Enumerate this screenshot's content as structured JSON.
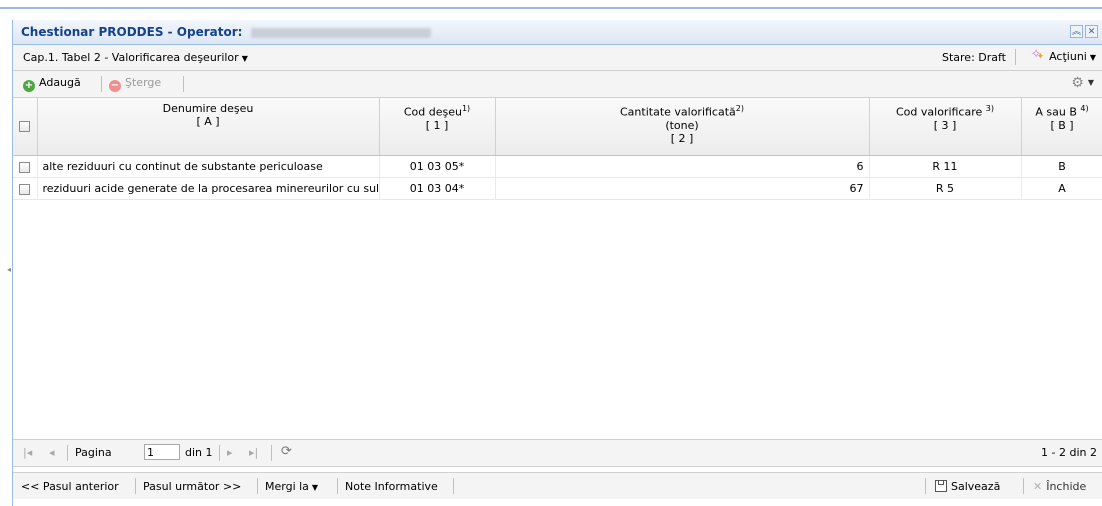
{
  "window": {
    "title": "Chestionar PRODDES - Operator:",
    "operator_redacted": true,
    "collapse_icon": "double-chevron-up-icon",
    "close_icon": "close-icon"
  },
  "subheader": {
    "chapter": "Cap.1. Tabel 2 - Valorificarea deşeurilor",
    "status": "Stare: Draft",
    "actions_label": "Acţiuni"
  },
  "toolbar": {
    "add_label": "Adaugă",
    "delete_label": "Şterge",
    "settings_icon": "gear-icon"
  },
  "table": {
    "columns": [
      {
        "label": "Denumire deşeu",
        "sup": "",
        "sub": "[ A ]"
      },
      {
        "label": "Cod deşeu",
        "sup": "1)",
        "sub": "[ 1 ]"
      },
      {
        "label": "Cantitate valorificată",
        "sup": "2)",
        "sub2": "(tone)",
        "sub": "[ 2 ]"
      },
      {
        "label": "Cod valorificare ",
        "sup": "3)",
        "sub": "[ 3 ]"
      },
      {
        "label": "A sau B ",
        "sup": "4)",
        "sub": "[ B ]"
      }
    ],
    "rows": [
      {
        "name": "alte reziduuri cu continut de substante periculoase",
        "code": "01 03 05*",
        "quantity": "6",
        "recovery_code": "R 11",
        "ab": "B"
      },
      {
        "name": "reziduuri acide generate de la procesarea minereurilor cu sulf",
        "code": "01 03 04*",
        "quantity": "67",
        "recovery_code": "R 5",
        "ab": "A"
      }
    ]
  },
  "pager": {
    "page_label": "Pagina",
    "page_value": "1",
    "of_label": "din 1",
    "info": "1 - 2 din 2"
  },
  "footer": {
    "prev": "<< Pasul anterior",
    "next": "Pasul următor >>",
    "goto": "Mergi la",
    "notes": "Note Informative",
    "save": "Salvează",
    "close": "Închide"
  }
}
